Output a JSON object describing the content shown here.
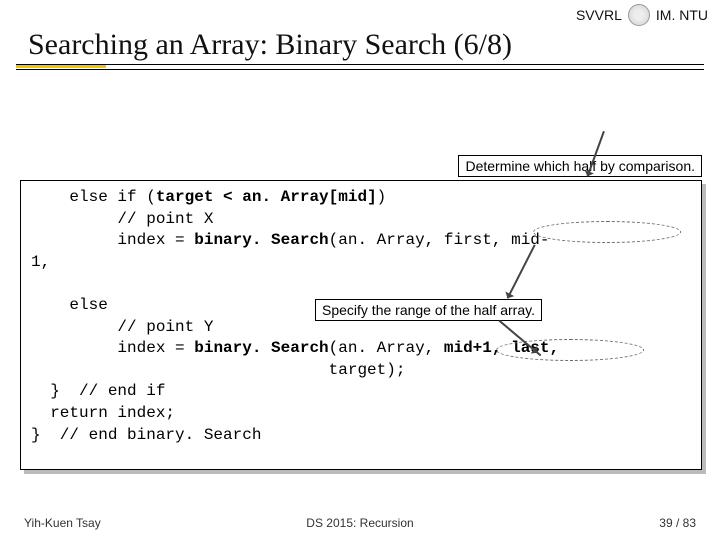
{
  "header": {
    "left_label": "SVVRL",
    "right_label": "IM. NTU"
  },
  "title": "Searching an Array: Binary Search (6/8)",
  "callouts": {
    "top": "Determine which half by comparison.",
    "mid": "Specify the range of the half array."
  },
  "code": {
    "l01a": "    else if (",
    "l01b": "target < an. Array[mid]",
    "l01c": ")",
    "l02": "         // point X",
    "l03a": "         index = ",
    "l03b": "binary. Search",
    "l03c": "(an. Array, first, mid-",
    "l04": "1,",
    "l05": "    else",
    "l06": "         // point Y",
    "l07a": "         index = ",
    "l07b": "binary. Search",
    "l07c": "(an. Array, ",
    "l07d": "mid+1, last,",
    "l08": "                               target);",
    "l09": "  }  // end if",
    "l10": "  return index;",
    "l11": "}  // end binary. Search"
  },
  "footer": {
    "left": "Yih-Kuen Tsay",
    "center": "DS 2015: Recursion",
    "page_cur": "39",
    "page_sep": " / ",
    "page_total": "83"
  }
}
